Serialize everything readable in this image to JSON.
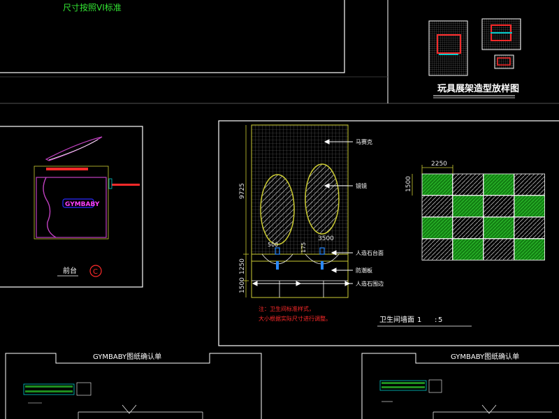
{
  "colors": {
    "background": "#000000",
    "frame": "#ffffff",
    "dimension": "#cccc33",
    "green_fill": "#1f8f1f",
    "hatch": "#9a9a9a",
    "red": "#ff2a2a",
    "magenta": "#c040c0",
    "blue": "#2a2aff",
    "cyan": "#00c8c8"
  },
  "top_left": {
    "note": "尺寸按照VI标准"
  },
  "toy_rack": {
    "title": "玩具展架造型放样图"
  },
  "front_desk": {
    "logo_text": "GYMBABY",
    "label": "前台",
    "mark": "C"
  },
  "bathroom": {
    "title": "卫生间墙面",
    "scale_left": "1",
    "scale_sep": ":",
    "scale_right": "5",
    "callouts": [
      {
        "text": "马赛克"
      },
      {
        "text": "镜镜"
      },
      {
        "text": "人造石台面"
      },
      {
        "text": "防潮板"
      },
      {
        "text": "人造石围边"
      }
    ],
    "dimensions": {
      "height_main": "9725",
      "height_mid": "1250",
      "height_low": "1500",
      "basin_width": "3500",
      "basin_left": "500",
      "basin_small": "175"
    },
    "notes": [
      "注：卫生间标准样式，",
      "大小根据实际尺寸进行调整。"
    ]
  },
  "tile_grid": {
    "width_dim": "2250",
    "height_dim": "1500",
    "rows": [
      [
        "green",
        "hatch",
        "green",
        "hatch"
      ],
      [
        "hatch",
        "green",
        "hatch",
        "green"
      ],
      [
        "green",
        "hatch",
        "green",
        "hatch"
      ],
      [
        "hatch",
        "green",
        "hatch",
        "green"
      ]
    ]
  },
  "confirm_left": {
    "title": "GYMBABY图纸确认单"
  },
  "confirm_right": {
    "title": "GYMBABY图纸确认单"
  }
}
